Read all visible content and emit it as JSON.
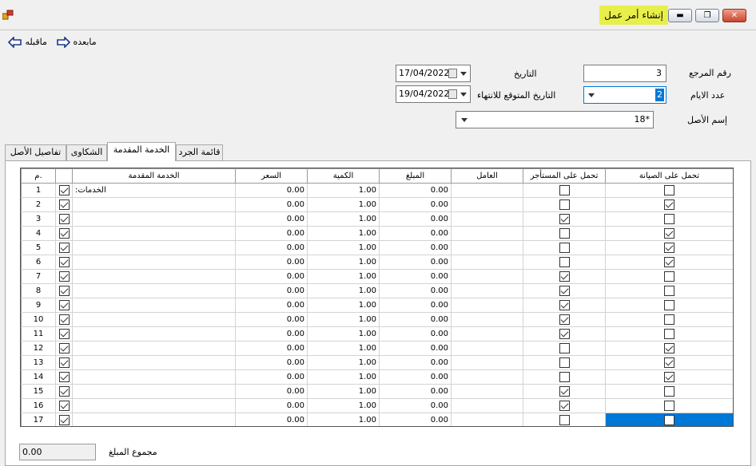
{
  "window": {
    "title": "إنشاء أمر عمل",
    "title_bg": "#e8ef4a"
  },
  "toolbar": {
    "prev_label": "ماقبله",
    "next_label": "مابعده"
  },
  "form": {
    "ref_label": "رقم المرجع",
    "ref_value": "3",
    "date_label": "التاريخ",
    "date_value": "17/04/2022",
    "days_label": "عدد الايام",
    "days_value": "2",
    "expected_label": "التاريخ المتوقع للانتهاء",
    "expected_value": "19/04/2022",
    "asset_label": "إسم الأصل",
    "asset_value": "18*"
  },
  "tabs": [
    {
      "label": "تفاصيل الأصل"
    },
    {
      "label": "الشكاوى"
    },
    {
      "label": "الخدمة المقدمة"
    },
    {
      "label": "قائمة الجرد"
    }
  ],
  "grid": {
    "headers": {
      "rownum": "م.",
      "service": "الخدمة المقدمة",
      "price": "السعر",
      "qty": "الكمية",
      "amount": "المبلغ",
      "worker": "العامل",
      "tenant": "تحمل على المستأجر",
      "maintenance": "تحمل على الصيانة"
    },
    "rows": [
      {
        "n": "1",
        "check": true,
        "service": ":الخدمات",
        "price": "0.00",
        "qty": "1.00",
        "amount": "0.00",
        "tenant": false,
        "maint": false
      },
      {
        "n": "2",
        "check": true,
        "service": "",
        "price": "0.00",
        "qty": "1.00",
        "amount": "0.00",
        "tenant": false,
        "maint": true
      },
      {
        "n": "3",
        "check": true,
        "service": "",
        "price": "0.00",
        "qty": "1.00",
        "amount": "0.00",
        "tenant": true,
        "maint": false
      },
      {
        "n": "4",
        "check": true,
        "service": "",
        "price": "0.00",
        "qty": "1.00",
        "amount": "0.00",
        "tenant": false,
        "maint": true
      },
      {
        "n": "5",
        "check": true,
        "service": "",
        "price": "0.00",
        "qty": "1.00",
        "amount": "0.00",
        "tenant": false,
        "maint": true
      },
      {
        "n": "6",
        "check": true,
        "service": "",
        "price": "0.00",
        "qty": "1.00",
        "amount": "0.00",
        "tenant": false,
        "maint": true
      },
      {
        "n": "7",
        "check": true,
        "service": "",
        "price": "0.00",
        "qty": "1.00",
        "amount": "0.00",
        "tenant": true,
        "maint": false
      },
      {
        "n": "8",
        "check": true,
        "service": "",
        "price": "0.00",
        "qty": "1.00",
        "amount": "0.00",
        "tenant": true,
        "maint": false
      },
      {
        "n": "9",
        "check": true,
        "service": "",
        "price": "0.00",
        "qty": "1.00",
        "amount": "0.00",
        "tenant": true,
        "maint": false
      },
      {
        "n": "10",
        "check": true,
        "service": "",
        "price": "0.00",
        "qty": "1.00",
        "amount": "0.00",
        "tenant": true,
        "maint": false
      },
      {
        "n": "11",
        "check": true,
        "service": "",
        "price": "0.00",
        "qty": "1.00",
        "amount": "0.00",
        "tenant": true,
        "maint": false
      },
      {
        "n": "12",
        "check": true,
        "service": "",
        "price": "0.00",
        "qty": "1.00",
        "amount": "0.00",
        "tenant": false,
        "maint": true
      },
      {
        "n": "13",
        "check": true,
        "service": "",
        "price": "0.00",
        "qty": "1.00",
        "amount": "0.00",
        "tenant": false,
        "maint": true
      },
      {
        "n": "14",
        "check": true,
        "service": "",
        "price": "0.00",
        "qty": "1.00",
        "amount": "0.00",
        "tenant": false,
        "maint": true
      },
      {
        "n": "15",
        "check": true,
        "service": "",
        "price": "0.00",
        "qty": "1.00",
        "amount": "0.00",
        "tenant": true,
        "maint": false
      },
      {
        "n": "16",
        "check": true,
        "service": "",
        "price": "0.00",
        "qty": "1.00",
        "amount": "0.00",
        "tenant": true,
        "maint": false
      },
      {
        "n": "17",
        "check": true,
        "service": "",
        "price": "0.00",
        "qty": "1.00",
        "amount": "0.00",
        "tenant": false,
        "maint": false,
        "selected": true
      }
    ]
  },
  "summary": {
    "total_label": "مجموع المبلغ",
    "total_value": "0.00"
  }
}
